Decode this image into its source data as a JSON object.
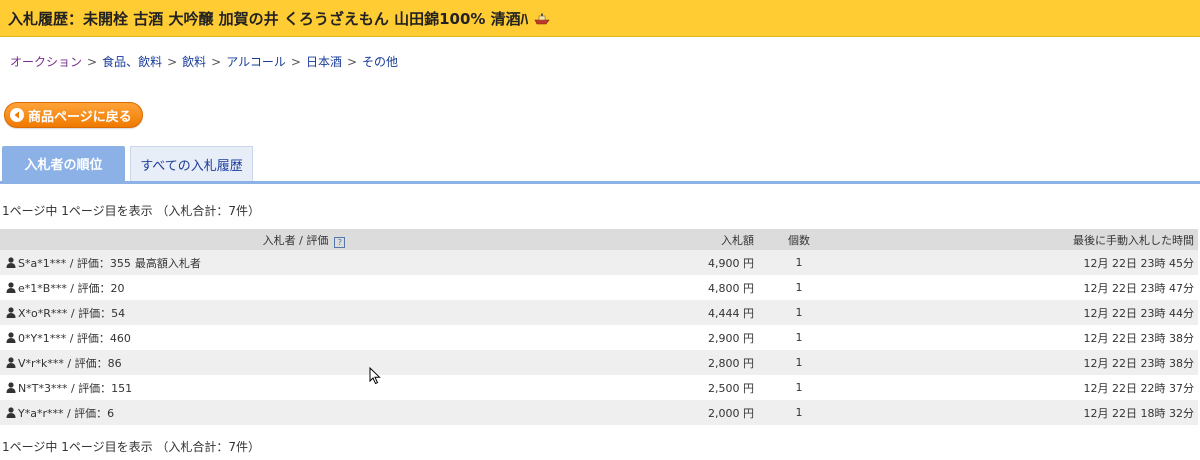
{
  "header": {
    "title": "入札履歴：未開栓 古酒 大吟醸 加賀の井 くろうざえもん 山田錦100% 清酒ﾊ",
    "icon": "ship-emoji-icon"
  },
  "breadcrumb": [
    {
      "label": "オークション"
    },
    {
      "label": "食品、飲料"
    },
    {
      "label": "飲料"
    },
    {
      "label": "アルコール"
    },
    {
      "label": "日本酒"
    },
    {
      "label": "その他"
    }
  ],
  "breadcrumb_separator": ">",
  "back_button": {
    "label": "商品ページに戻る",
    "icon": "left-arrow-circle-icon"
  },
  "tabs": [
    {
      "label": "入札者の順位",
      "active": true
    },
    {
      "label": "すべての入札履歴",
      "active": false
    }
  ],
  "summary": "1ページ中 1ページ目を表示 （入札合計：7件）",
  "table": {
    "headers": {
      "bidder": "入札者 / 評価",
      "help": "?",
      "price": "入札額",
      "quantity": "個数",
      "last_bid": "最後に手動入札した時間"
    },
    "rows": [
      {
        "bidder": "S*a*1*** / 評価：355",
        "badge": "最高額入札者",
        "price": "4,900 円",
        "quantity": "1",
        "time": "12月 22日 23時 45分"
      },
      {
        "bidder": "e*1*B*** / 評価：20",
        "badge": "",
        "price": "4,800 円",
        "quantity": "1",
        "time": "12月 22日 23時 47分"
      },
      {
        "bidder": "X*o*R*** / 評価：54",
        "badge": "",
        "price": "4,444 円",
        "quantity": "1",
        "time": "12月 22日 23時 44分"
      },
      {
        "bidder": "0*Y*1*** / 評価：460",
        "badge": "",
        "price": "2,900 円",
        "quantity": "1",
        "time": "12月 22日 23時 38分"
      },
      {
        "bidder": "V*r*k*** / 評価：86",
        "badge": "",
        "price": "2,800 円",
        "quantity": "1",
        "time": "12月 22日 23時 38分"
      },
      {
        "bidder": "N*T*3*** / 評価：151",
        "badge": "",
        "price": "2,500 円",
        "quantity": "1",
        "time": "12月 22日 22時 37分"
      },
      {
        "bidder": "Y*a*r*** / 評価：6",
        "badge": "",
        "price": "2,000 円",
        "quantity": "1",
        "time": "12月 22日 18時 32分"
      }
    ]
  },
  "colors": {
    "title_bar": "#ffcc33",
    "tab_active": "#8cb1e6",
    "button_orange": "#f07a00",
    "link_blue": "#1a3d99"
  }
}
